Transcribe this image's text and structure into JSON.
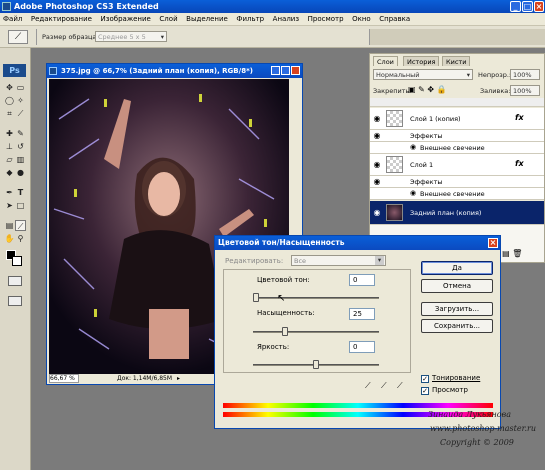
{
  "app": {
    "title": "Adobe Photoshop CS3 Extended"
  },
  "menu": [
    "Файл",
    "Редактирование",
    "Изображение",
    "Слой",
    "Выделение",
    "Фильтр",
    "Анализ",
    "Просмотр",
    "Окно",
    "Справка"
  ],
  "options": {
    "sample_label": "Размер образца:",
    "sample_value": "Среднее 5 x 5"
  },
  "document": {
    "title": "375.jpg @ 66,7% (Задний план (копия), RGB/8*)",
    "zoom": "66,67 %",
    "doc_info": "Док: 1,14M/6,85M"
  },
  "layers": {
    "tabs": [
      "Слои",
      "История",
      "Кисти"
    ],
    "blend_mode": "Нормальный",
    "opacity_label": "Непрозр.:",
    "opacity_value": "100%",
    "lock_label": "Закрепить:",
    "fill_label": "Заливка:",
    "fill_value": "100%",
    "rows": [
      {
        "name": "Слой 1 (копия)",
        "fx": "fx"
      },
      {
        "name": "Эффекты"
      },
      {
        "name": "Внешнее свечение"
      },
      {
        "name": "Слой 1",
        "fx": "fx"
      },
      {
        "name": "Эффекты"
      },
      {
        "name": "Внешнее свечение"
      },
      {
        "name": "Задний план (копия)"
      }
    ]
  },
  "dialog": {
    "title": "Цветовой тон/Насыщенность",
    "edit_label": "Редактировать:",
    "edit_value": "Все",
    "hue_label": "Цветовой тон:",
    "hue_value": "0",
    "saturation_label": "Насыщенность:",
    "saturation_value": "25",
    "lightness_label": "Яркость:",
    "lightness_value": "0",
    "buttons": {
      "ok": "Да",
      "cancel": "Отмена",
      "load": "Загрузить...",
      "save": "Сохранить..."
    },
    "colorize_label": "Тонирование",
    "preview_label": "Просмотр",
    "colorize_checked": true,
    "preview_checked": true
  },
  "watermark": {
    "author": "Зинаида Лукьянова",
    "site": "www.photoshop-master.ru",
    "copyright": "Copyright © 2009"
  }
}
